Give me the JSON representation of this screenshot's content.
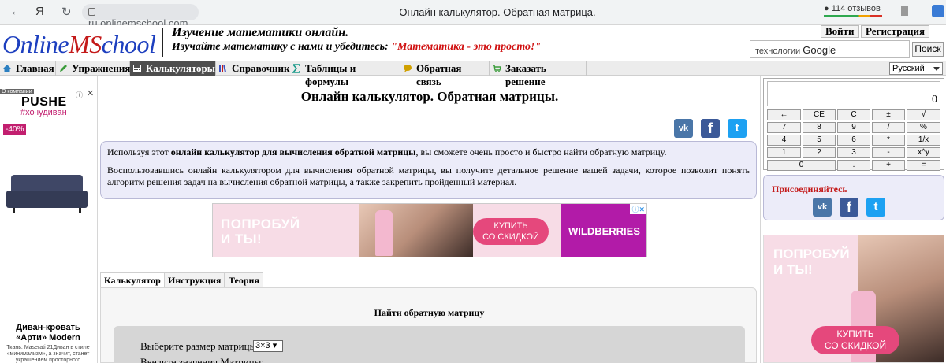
{
  "browser": {
    "back": "←",
    "brand": "Я",
    "reload": "↻",
    "url": "ru.onlinemschool.com",
    "title": "Онлайн калькулятор. Обратная матрица.",
    "reviews": "114 отзывов"
  },
  "header": {
    "logo_part1": "Online",
    "logo_part2": "MS",
    "logo_part3": "chool",
    "slogan1": "Изучение математики онлайн.",
    "slogan2": "Изучайте математику с нами и убедитесь:",
    "slogan_quote": "\"Математика - это просто!\"",
    "login": "Войти",
    "register": "Регистрация",
    "search_placeholder": "технологии",
    "search_brand": "Google",
    "search_button": "Поиск"
  },
  "nav": {
    "items": [
      {
        "label": "Главная",
        "icon": "home-icon",
        "color": "#2b7fc1"
      },
      {
        "label": "Упражнения",
        "icon": "pencil-icon",
        "color": "#3a9b3a"
      },
      {
        "label": "Калькуляторы",
        "icon": "calculator-icon",
        "color": "#ffffff"
      },
      {
        "label": "Справочник",
        "icon": "books-icon",
        "color": "#3a4fbf"
      },
      {
        "label": "Таблицы и формулы",
        "icon": "sigma-icon",
        "color": "#1a9a8a"
      },
      {
        "label": "Обратная связь",
        "icon": "chat-icon",
        "color": "#d0a000"
      },
      {
        "label": "Заказать решение",
        "icon": "cart-icon",
        "color": "#3a9b3a"
      }
    ],
    "language": "Русский"
  },
  "left_ad": {
    "company": "О компании",
    "brand": "PUSHE",
    "tag": "#хочудиван",
    "discount": "-40%",
    "title": "Диван-кровать «Арти» Modern",
    "desc": "Ткань: Maserati 21Диван в стиле «минимализм», а значит, станет украшением просторного"
  },
  "main": {
    "title": "Онлайн калькулятор. Обратная матрицы.",
    "social": {
      "vk": "vk",
      "fb": "f",
      "tw": "t"
    },
    "intro_pre": "Используя этот ",
    "intro_bold": "онлайн калькулятор для вычисления обратной матрицы",
    "intro_post": ", вы сможете очень просто и быстро найти обратную матрицу.",
    "intro2": "Воспользовавшись онлайн калькулятором для вычисления обратной матрицы, вы получите детальное решение вашей задачи, которое позволит понять алгоритм решения задач на вычисления обратной матрицы, а также закрепить пройденный материал.",
    "ad_text1": "ПОПРОБУЙ",
    "ad_text2": "И ТЫ!",
    "ad_buy1": "КУПИТЬ",
    "ad_buy2": "СО СКИДКОЙ",
    "ad_brand": "WILDBERRIES",
    "tabs": [
      "Калькулятор",
      "Инструкция",
      "Теория"
    ],
    "panel_title": "Найти обратную матрицу",
    "size_label": "Выберите размер матрицы:",
    "size_value": "3×3",
    "values_label": "Введите значения Матрицы:"
  },
  "calculator": {
    "display": "0",
    "keys": [
      [
        "←",
        "CE",
        "C",
        "±",
        "√"
      ],
      [
        "7",
        "8",
        "9",
        "/",
        "%"
      ],
      [
        "4",
        "5",
        "6",
        "*",
        "1/x"
      ],
      [
        "1",
        "2",
        "3",
        "-",
        "x^y"
      ],
      [
        "0",
        ".",
        "+",
        "="
      ]
    ]
  },
  "join": {
    "title": "Присоединяйтесь",
    "vk": "vk",
    "fb": "f",
    "tw": "t"
  },
  "right_ad": {
    "text1": "ПОПРОБУЙ",
    "text2": "И ТЫ!",
    "buy1": "КУПИТЬ",
    "buy2": "СО СКИДКОЙ"
  },
  "colors": {
    "vk": "#4a76a8",
    "fb": "#3b5998",
    "tw": "#1da1f2",
    "accent_red": "#c41a1a",
    "logo_blue": "#1d3fbf"
  }
}
